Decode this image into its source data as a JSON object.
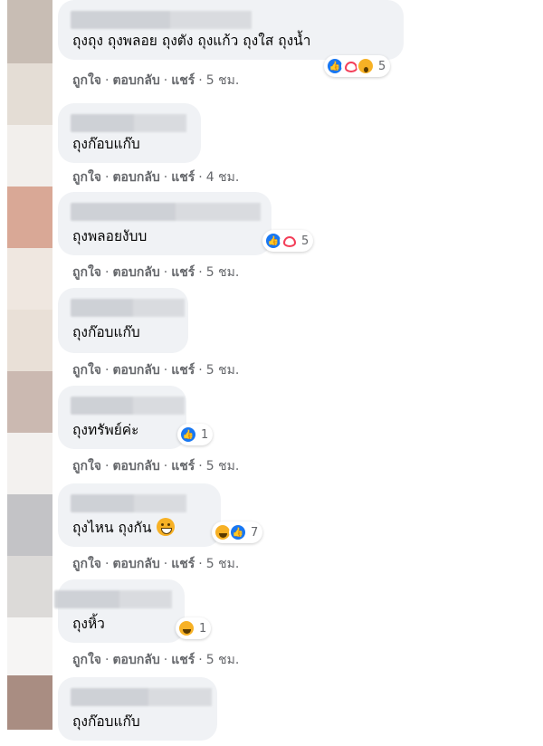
{
  "action_labels": {
    "like": "ถูกใจ",
    "reply": "ตอบกลับ",
    "share": "แชร์",
    "separator": "·"
  },
  "comments": [
    {
      "text": "ถุงถุง ถุงพลอย ถุงตัง ถุงแก้ว ถุงใส ถุงน้ำ",
      "reactions": [
        "like-icon",
        "love-icon",
        "wow-icon"
      ],
      "reaction_count": "5",
      "time": "5 ชม."
    },
    {
      "text": "ถุงก๊อบแก๊บ",
      "reactions": [],
      "reaction_count": "",
      "time": "4 ชม."
    },
    {
      "text": "ถุงพลอยงับบ",
      "reactions": [
        "like-icon",
        "love-icon"
      ],
      "reaction_count": "5",
      "time": "5 ชม."
    },
    {
      "text": "ถุงก๊อบแก๊บ",
      "reactions": [],
      "reaction_count": "",
      "time": "5 ชม."
    },
    {
      "text": "ถุงทรัพย์ค่ะ",
      "reactions": [
        "like-icon"
      ],
      "reaction_count": "1",
      "time": "5 ชม."
    },
    {
      "text": "ถุงไหน ถุงกัน",
      "inline_emoji": "grinning-face-icon",
      "reactions": [
        "haha-icon",
        "like-icon"
      ],
      "reaction_count": "7",
      "time": "5 ชม."
    },
    {
      "text": "ถุงหิ้ว",
      "reactions": [
        "haha-icon"
      ],
      "reaction_count": "1",
      "time": "5 ชม."
    },
    {
      "text": "ถุงก๊อบแก๊บ",
      "reactions": [],
      "reaction_count": "",
      "time": ""
    }
  ],
  "colors": {
    "bubble": "#f0f2f5",
    "meta_text": "#65676b",
    "like_blue": "#1877f2",
    "love_red": "#f33e58",
    "emoji_yellow": "#f7b125"
  }
}
